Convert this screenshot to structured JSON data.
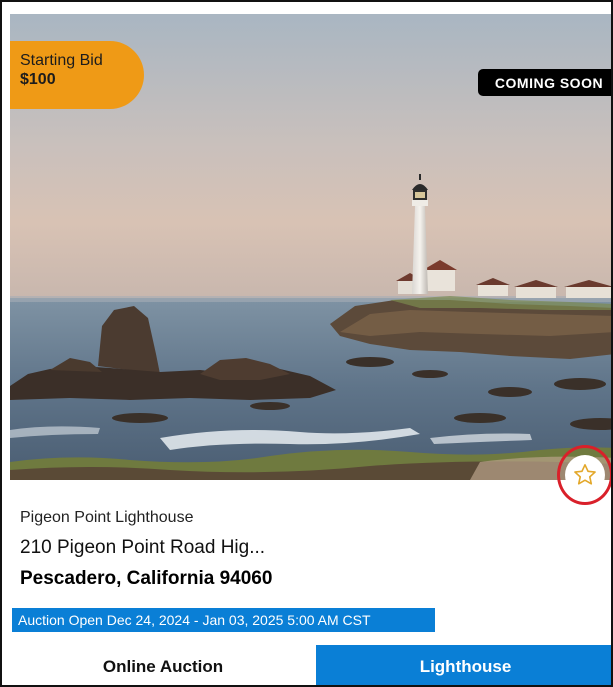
{
  "listing": {
    "starting_bid_label": "Starting Bid",
    "starting_bid_value": "$100",
    "status": "COMING SOON",
    "name": "Pigeon Point Lighthouse",
    "address_line1": "210 Pigeon Point Road Hig...",
    "address_line2": "Pescadero, California 94060",
    "auction_dates": "Auction Open Dec 24, 2024 - Jan 03, 2025 5:00 AM CST",
    "sale_type": "Online Auction",
    "property_type": "Lighthouse"
  },
  "icons": {
    "favorite": "star-outline-icon"
  },
  "colors": {
    "bid_badge": "#ef9a16",
    "accent_blue": "#0a7fd6",
    "status_badge": "#000000",
    "favorite_ring": "#d9202a",
    "star": "#e3a82b"
  }
}
